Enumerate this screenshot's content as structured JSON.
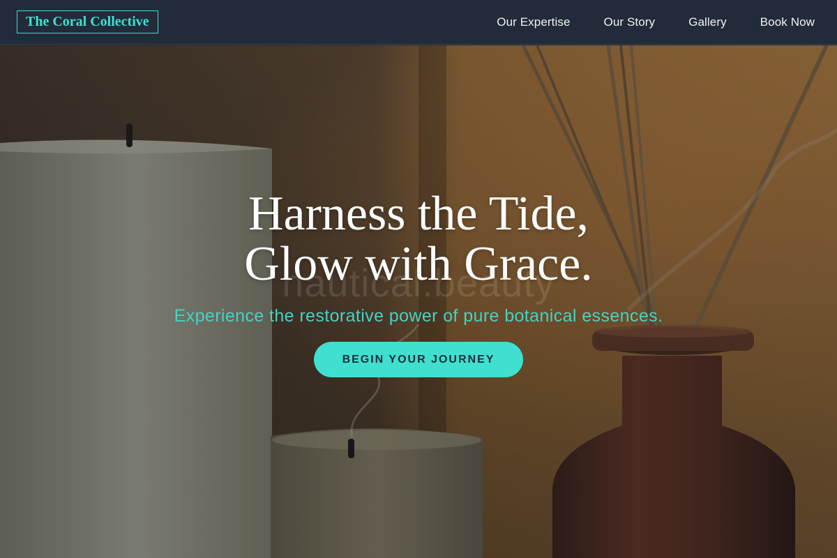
{
  "header": {
    "logo": "The Coral Collective",
    "nav": [
      {
        "label": "Our Expertise"
      },
      {
        "label": "Our Story"
      },
      {
        "label": "Gallery"
      },
      {
        "label": "Book Now"
      }
    ]
  },
  "hero": {
    "headline_line1": "Harness the Tide,",
    "headline_line2": "Glow with Grace.",
    "watermark": "nautical.beauty",
    "subheadline": "Experience the restorative power of pure botanical essences.",
    "cta_label": "BEGIN YOUR JOURNEY",
    "background_image": "candles-and-reed-diffuser"
  },
  "colors": {
    "accent": "#40e0d0",
    "header_bg": "#222b3a",
    "cta_text": "#1e2a38",
    "headline": "#ffffff"
  }
}
